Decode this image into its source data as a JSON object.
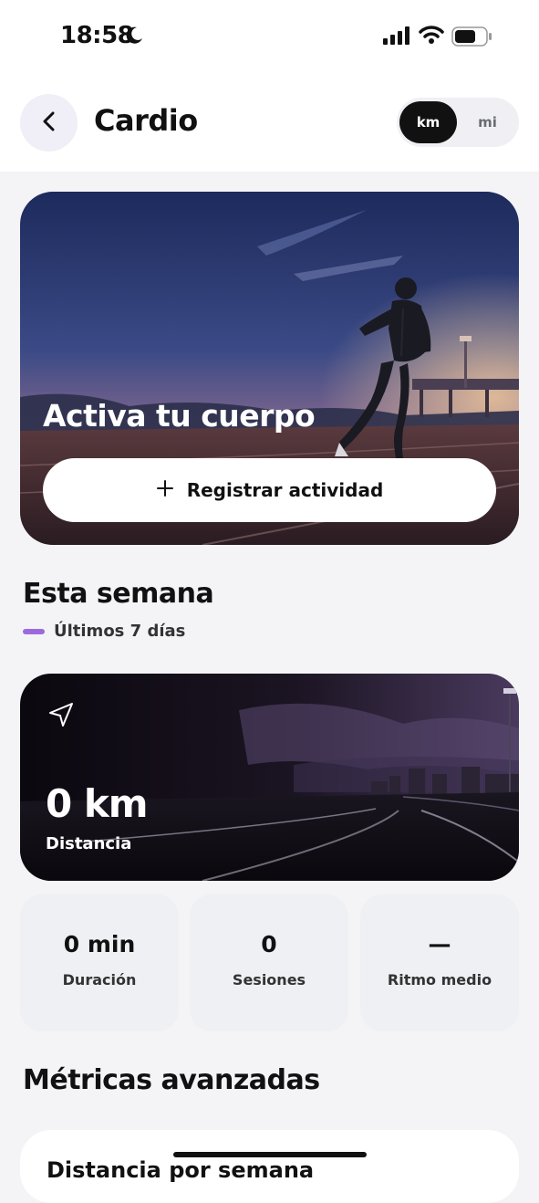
{
  "status_bar": {
    "time": "18:58",
    "icons": [
      "moon-icon",
      "signal-icon",
      "wifi-icon",
      "battery-icon"
    ]
  },
  "header": {
    "title": "Cardio",
    "back_icon": "chevron-left-icon",
    "unit_toggle": {
      "options": [
        "km",
        "mi"
      ],
      "selected": "km"
    }
  },
  "hero": {
    "title": "Activa tu cuerpo",
    "button_label": "Registrar actividad",
    "button_icon": "plus-icon"
  },
  "week": {
    "title": "Esta semana",
    "subtitle": "Últimos 7 días",
    "accent_color": "#9b6bdd"
  },
  "distance": {
    "icon": "navigation-arrow-icon",
    "value": "0 km",
    "label": "Distancia"
  },
  "stats": [
    {
      "value": "0 min",
      "label": "Duración"
    },
    {
      "value": "0",
      "label": "Sesiones"
    },
    {
      "value": "—",
      "label": "Ritmo medio"
    }
  ],
  "advanced": {
    "title": "Métricas avanzadas",
    "first_card_title": "Distancia por semana"
  }
}
